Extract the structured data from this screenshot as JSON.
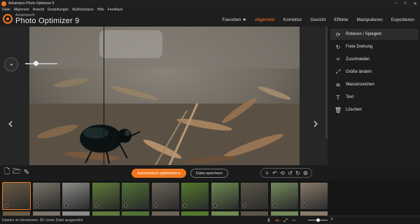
{
  "window": {
    "title": "Ashampoo Photo Optimizer 9",
    "controls": [
      "–",
      "□",
      "✕"
    ]
  },
  "menu": [
    "Datei",
    "Allgemein",
    "Ansicht",
    "Einstellungen",
    "MyAshampoo",
    "Hilfe",
    "Feedback"
  ],
  "brand": {
    "small": "Ashampoo®",
    "name": "Photo Optimizer 9"
  },
  "tabs": [
    {
      "label": "Favoriten ★",
      "active": false
    },
    {
      "label": "Allgemein",
      "active": true
    },
    {
      "label": "Korrektur",
      "active": false
    },
    {
      "label": "Gesicht",
      "active": false
    },
    {
      "label": "Effekte",
      "active": false
    },
    {
      "label": "Manipulieren",
      "active": false
    },
    {
      "label": "Exportieren",
      "active": false
    }
  ],
  "viewer": {
    "prev_glyph": "‹",
    "next_glyph": "›"
  },
  "panel": {
    "items": [
      {
        "label": "Rotieren / Spiegeln",
        "icon": "rotate-icon",
        "glyph": "⟳"
      },
      {
        "label": "Freie Drehung",
        "icon": "free-rotate-icon",
        "glyph": "↻"
      },
      {
        "label": "Zuschneiden",
        "icon": "crop-icon",
        "glyph": "⌗"
      },
      {
        "label": "Größe ändern",
        "icon": "resize-icon",
        "glyph": "⤢"
      },
      {
        "label": "Wasserzeichen",
        "icon": "watermark-icon",
        "glyph": "≋"
      },
      {
        "label": "Text",
        "icon": "text-icon",
        "glyph": "T"
      },
      {
        "label": "Löschen",
        "icon": "delete-icon",
        "glyph": "🗑"
      }
    ]
  },
  "toolbar": {
    "optimize_label": "Automatisch optimieren ▸",
    "save_label": "Datei speichern",
    "left_icons": [
      {
        "name": "open-file-icon",
        "glyph": "🗋"
      },
      {
        "name": "open-folder-icon",
        "glyph": "🗁"
      },
      {
        "name": "brush-icon",
        "glyph": "✎"
      }
    ],
    "right_icons": [
      {
        "name": "magic-wand-icon",
        "glyph": "✧"
      },
      {
        "name": "undo-icon",
        "glyph": "↶"
      },
      {
        "name": "undo-all-icon",
        "glyph": "⟲"
      },
      {
        "name": "rotate-left-icon",
        "glyph": "↺"
      },
      {
        "name": "rotate-right-icon",
        "glyph": "↻"
      },
      {
        "name": "settings-icon",
        "glyph": "⚙"
      }
    ]
  },
  "filmstrip": {
    "thumbs": [
      {
        "color": "#6a5a44",
        "selected": true
      },
      {
        "color": "#7a7468",
        "selected": false
      },
      {
        "color": "#8a8c88",
        "selected": false
      },
      {
        "color": "#5f7a3a",
        "selected": false
      },
      {
        "color": "#4f7236",
        "selected": false
      },
      {
        "color": "#6b6458",
        "selected": false
      },
      {
        "color": "#527a2e",
        "selected": false
      },
      {
        "color": "#6f8a52",
        "selected": false
      },
      {
        "color": "#5c5648",
        "selected": false
      },
      {
        "color": "#748a5e",
        "selected": false
      },
      {
        "color": "#8a7a6a",
        "selected": false
      }
    ]
  },
  "status": {
    "text": "Dateien im Verzeichnis: 28 / keine Datei ausgewählt",
    "icons": [
      {
        "name": "split-view-icon",
        "glyph": "⇕",
        "accent": false
      },
      {
        "name": "compare-icon",
        "glyph": "⇔",
        "accent": true
      },
      {
        "name": "fullscreen-icon",
        "glyph": "⤢",
        "accent": false
      },
      {
        "name": "zoom-out-icon",
        "glyph": "−",
        "accent": false
      }
    ],
    "zoom_plus": "+"
  },
  "colors": {
    "accent": "#f07820",
    "panel_bg": "#1c1c1c",
    "app_bg": "#1a1a1a"
  }
}
